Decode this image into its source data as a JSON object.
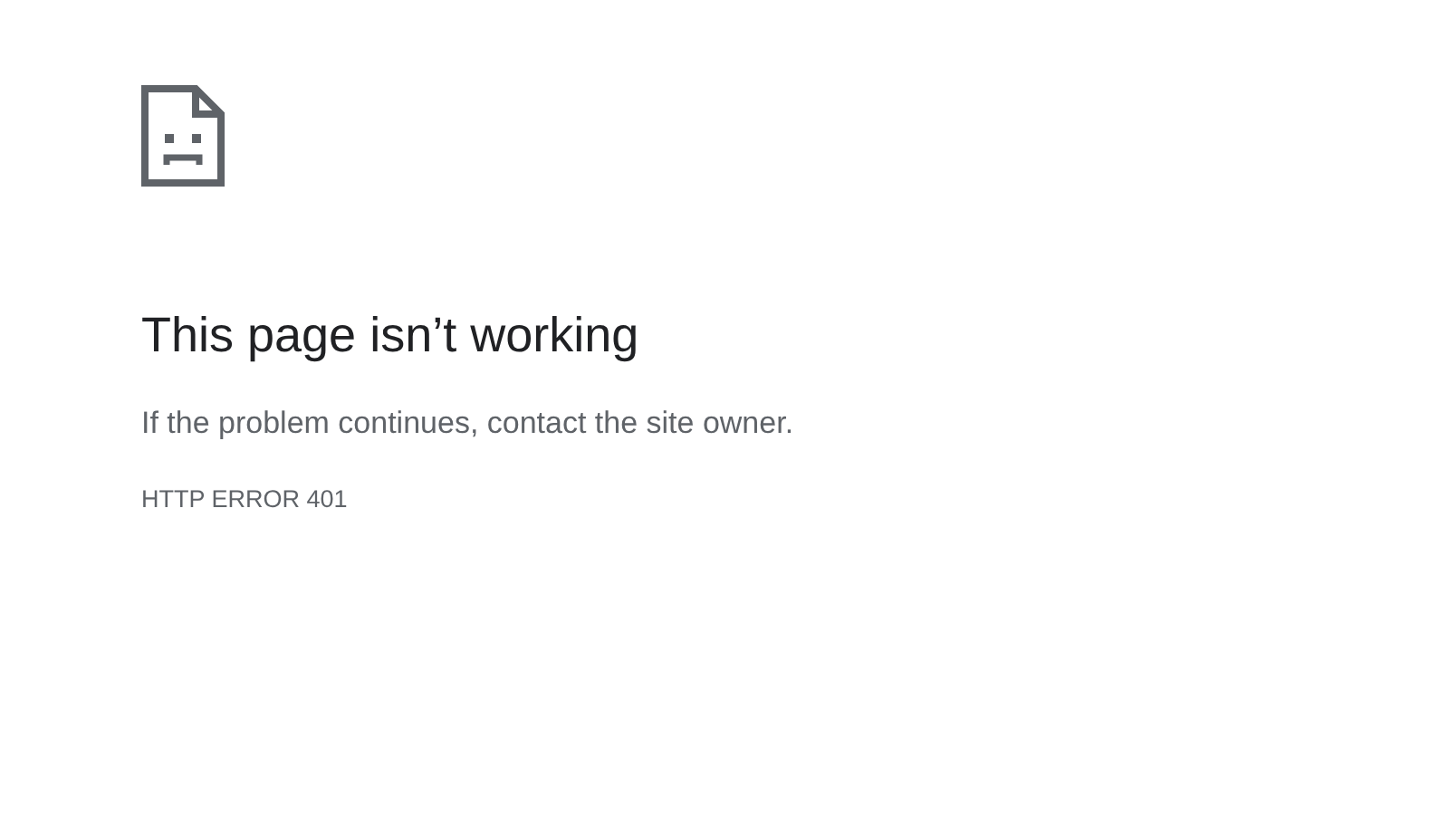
{
  "error_page": {
    "title": "This page isn’t working",
    "message": "If the problem continues, contact the site owner.",
    "error_code": "HTTP ERROR 401"
  }
}
